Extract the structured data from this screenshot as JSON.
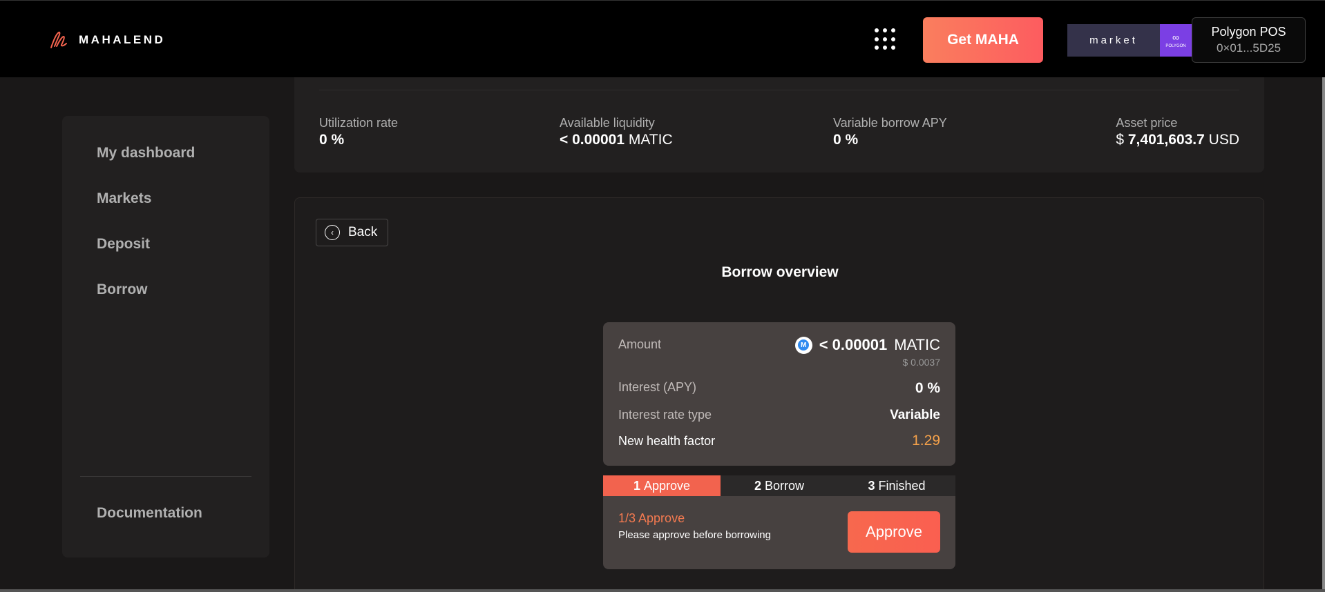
{
  "header": {
    "logo_text": "MAHALEND",
    "get_maha_label": "Get MAHA",
    "market_label": "market",
    "polygon_badge_text": "POLYGON",
    "network_name": "Polygon POS",
    "wallet_address": "0×01...5D25"
  },
  "sidebar": {
    "items": [
      {
        "label": "My dashboard"
      },
      {
        "label": "Markets"
      },
      {
        "label": "Deposit"
      },
      {
        "label": "Borrow"
      }
    ],
    "documentation_label": "Documentation"
  },
  "stats": {
    "utilization": {
      "label": "Utilization rate",
      "value": "0",
      "unit": "%"
    },
    "liquidity": {
      "label": "Available liquidity",
      "value": "< 0.00001",
      "unit": "MATIC"
    },
    "variable_apy": {
      "label": "Variable borrow APY",
      "value": "0",
      "unit": "%"
    },
    "asset_price": {
      "label": "Asset price",
      "prefix": "$",
      "value": "7,401,603.7",
      "unit": "USD"
    }
  },
  "main": {
    "back_label": "Back",
    "title": "Borrow overview",
    "summary": {
      "amount_label": "Amount",
      "amount_value": "< 0.00001",
      "amount_unit": "MATIC",
      "amount_usd": "$ 0.0037",
      "interest_label": "Interest (APY)",
      "interest_value": "0 %",
      "rate_type_label": "Interest rate type",
      "rate_type_value": "Variable",
      "health_label": "New health factor",
      "health_value": "1.29"
    },
    "steps": [
      {
        "num": "1",
        "label": "Approve",
        "active": true
      },
      {
        "num": "2",
        "label": "Borrow",
        "active": false
      },
      {
        "num": "3",
        "label": "Finished",
        "active": false
      }
    ],
    "step_panel": {
      "title": "1/3 Approve",
      "description": "Please approve before borrowing",
      "button_label": "Approve"
    }
  },
  "colors": {
    "accent": "#f2634e",
    "health": "#f5a14a",
    "polygon": "#7b3fe4"
  }
}
